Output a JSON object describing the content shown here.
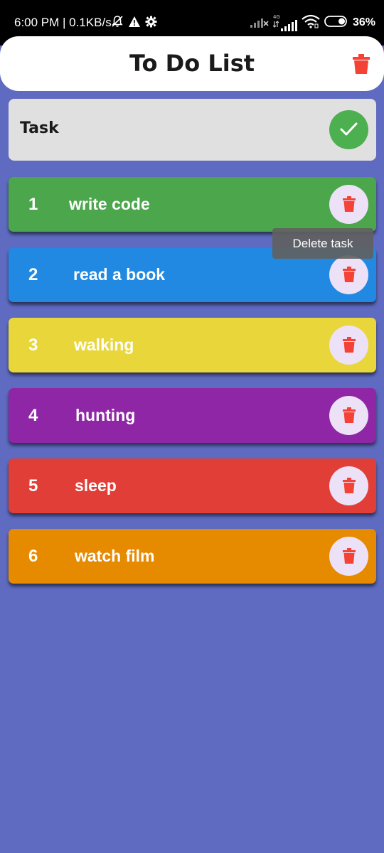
{
  "status_bar": {
    "time_speed": "6:00 PM | 0.1KB/s",
    "network_label": "4G",
    "battery": "36%",
    "icons": [
      "bell-off-icon",
      "warning-icon",
      "gear-icon",
      "signal-icon",
      "signal-4g-icon",
      "wifi-icon",
      "battery-icon"
    ]
  },
  "app_bar": {
    "title": "To Do List",
    "delete_all_icon": "trash-icon",
    "delete_all_color": "#f44336"
  },
  "task_input": {
    "placeholder": "Task",
    "add_icon": "check-icon",
    "add_button_color": "#4caf50"
  },
  "tasks": [
    {
      "number": "1",
      "text": "write code",
      "color": "#4ca64c"
    },
    {
      "number": "2",
      "text": "read a book",
      "color": "#2189e1"
    },
    {
      "number": "3",
      "text": "walking",
      "color": "#e8d63b"
    },
    {
      "number": "4",
      "text": "hunting",
      "color": "#8e26a5"
    },
    {
      "number": "5",
      "text": "sleep",
      "color": "#e03e37"
    },
    {
      "number": "6",
      "text": "watch film",
      "color": "#e68a00"
    }
  ],
  "tooltip": {
    "text": "Delete task"
  },
  "colors": {
    "background": "#5f6bc1",
    "delete_button_bg": "#ede1f8",
    "trash_icon": "#f44336"
  }
}
